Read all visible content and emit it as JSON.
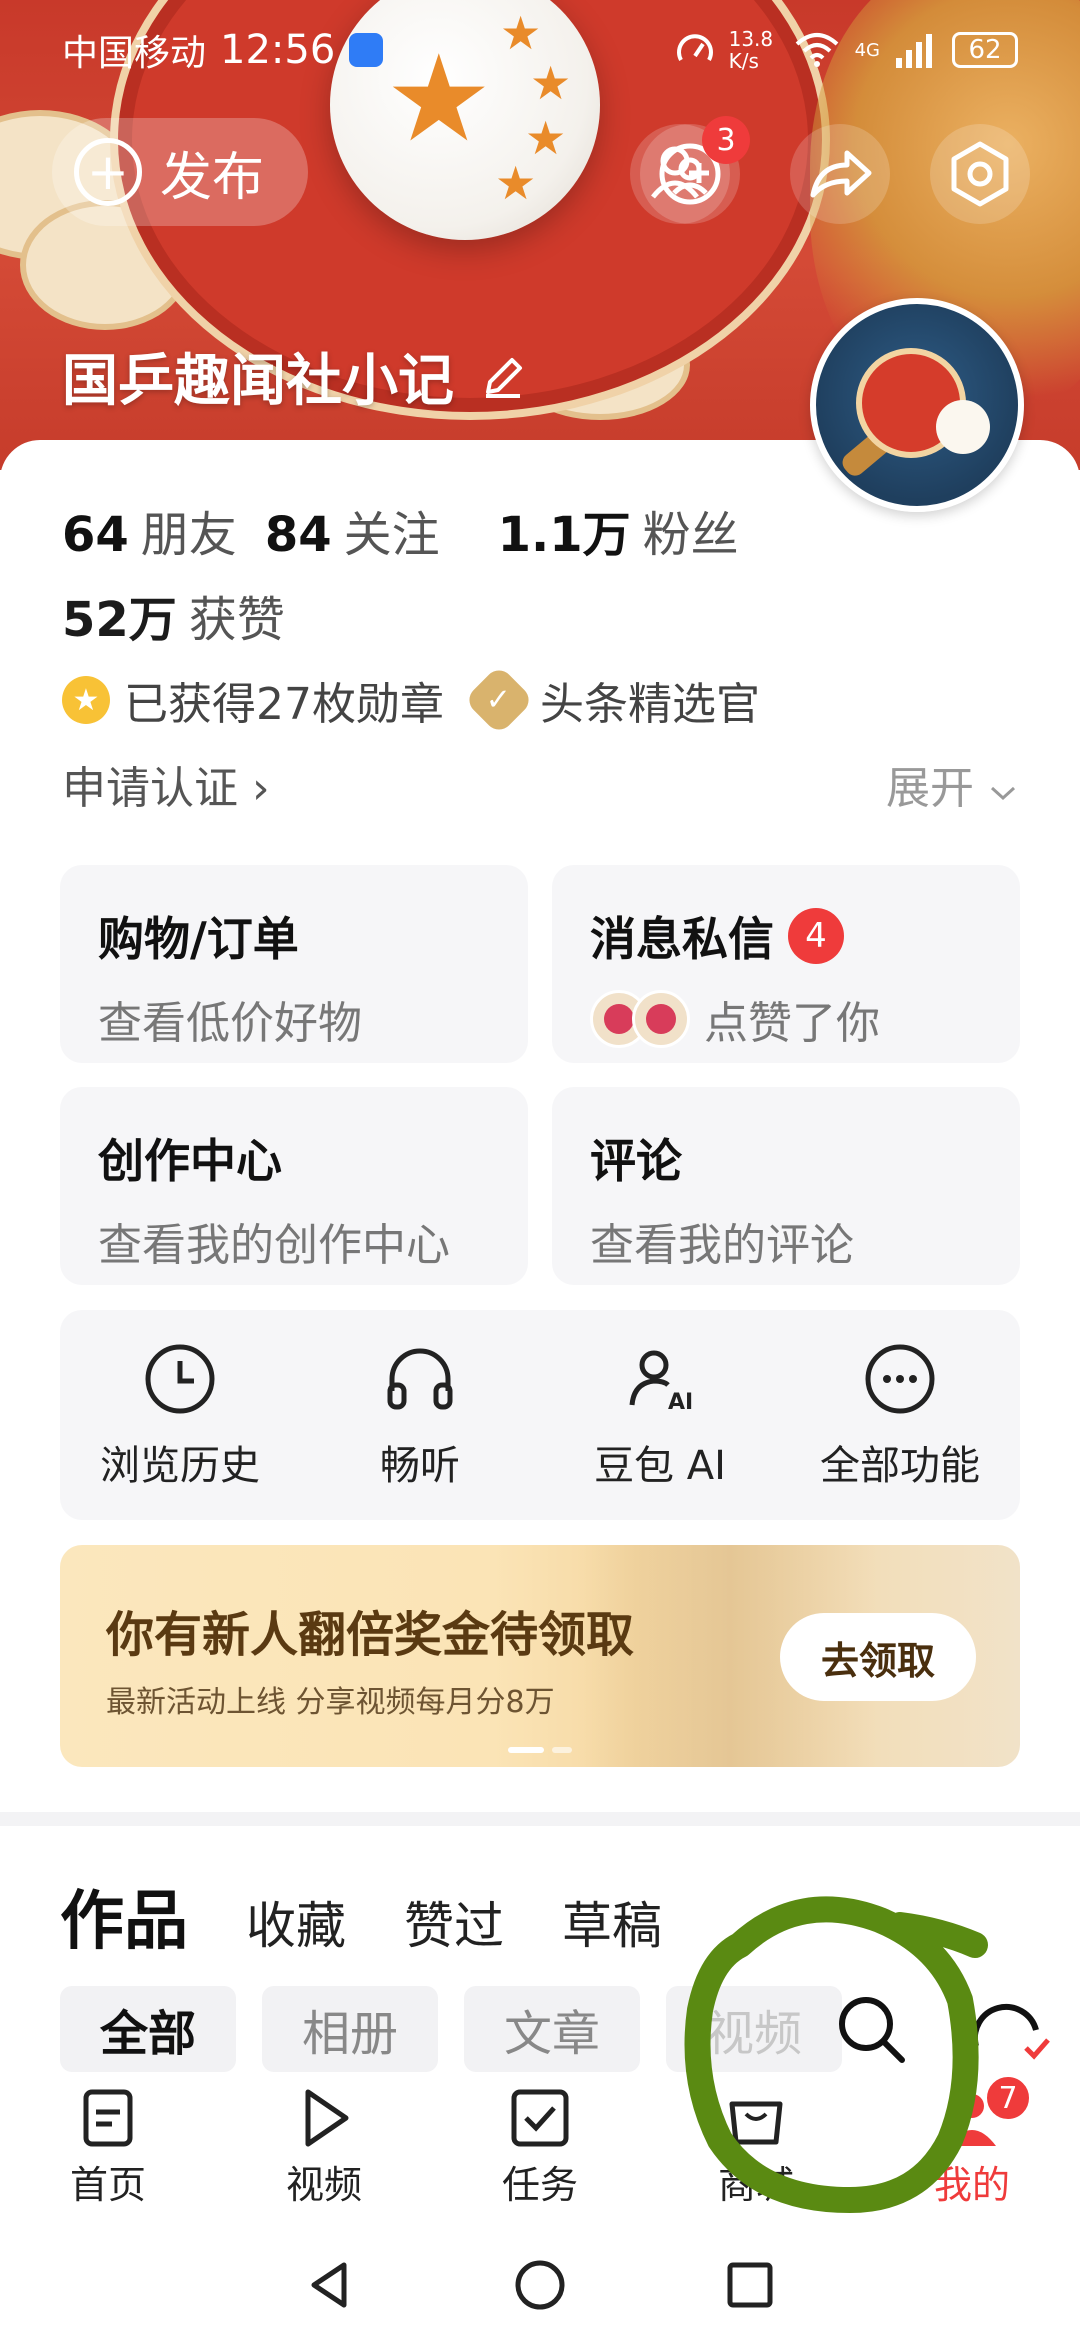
{
  "status_bar": {
    "carrier": "中国移动",
    "time": "12:56",
    "net_speed": "13.8 K/s",
    "network": "4G",
    "battery": "62"
  },
  "header": {
    "publish_label": "发布",
    "visitors_badge": "3",
    "nickname": "国乒趣闻社小记"
  },
  "stats": {
    "friends_num": "64",
    "friends_label": "朋友",
    "following_num": "84",
    "following_label": "关注",
    "fans_num": "1.1万",
    "fans_label": "粉丝",
    "likes_num": "52万",
    "likes_label": "获赞"
  },
  "badges": {
    "medals": "已获得27枚勋章",
    "selector": "头条精选官"
  },
  "verify_label": "申请认证 ›",
  "expand_label": "展开",
  "tiles": {
    "shopping_title": "购物/订单",
    "shopping_sub": "查看低价好物",
    "messages_title": "消息私信",
    "messages_count": "4",
    "messages_sub": "点赞了你",
    "creator_title": "创作中心",
    "creator_sub": "查看我的创作中心",
    "comments_title": "评论",
    "comments_sub": "查看我的评论"
  },
  "features": [
    {
      "label": "浏览历史",
      "icon": "clock-icon"
    },
    {
      "label": "畅听",
      "icon": "headphones-icon"
    },
    {
      "label": "豆包 AI",
      "icon": "ai-assistant-icon"
    },
    {
      "label": "全部功能",
      "icon": "more-icon"
    }
  ],
  "promo": {
    "title": "你有新人翻倍奖金待领取",
    "subtitle": "最新活动上线 分享视频每月分8万",
    "button": "去领取"
  },
  "content_tabs": [
    "作品",
    "收藏",
    "赞过",
    "草稿"
  ],
  "filter_chips": [
    "全部",
    "相册",
    "文章",
    "视频"
  ],
  "bottom_nav": [
    {
      "label": "首页",
      "icon": "home-icon"
    },
    {
      "label": "视频",
      "icon": "video-play-icon"
    },
    {
      "label": "任务",
      "icon": "task-check-icon"
    },
    {
      "label": "商城",
      "icon": "mall-icon"
    },
    {
      "label": "我的",
      "icon": "profile-icon",
      "badge": "7"
    }
  ],
  "colors": {
    "accent_red": "#ef3b3b",
    "banner_red": "#c8392a",
    "promo_gold": "#fbe7bd",
    "scribble_green": "#5a8a12"
  }
}
